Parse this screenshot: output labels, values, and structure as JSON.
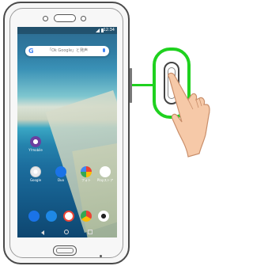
{
  "statusbar": {
    "time": "12:34"
  },
  "search": {
    "g_logo": "G",
    "hint": "「Ok Google」と発声"
  },
  "apps": {
    "ymobile": {
      "label": "Y!mobile"
    },
    "google": {
      "label": "Google"
    },
    "duo": {
      "label": "Duo"
    },
    "photos": {
      "label": "フォト"
    },
    "play": {
      "label": "Playストア"
    }
  },
  "dock": {
    "apps": [
      "phone-app",
      "messages-app",
      "gmail-app",
      "chrome-app",
      "camera-app"
    ]
  },
  "colors": {
    "accent_green": "#1fd11f",
    "frame": "#4a4a4a"
  }
}
